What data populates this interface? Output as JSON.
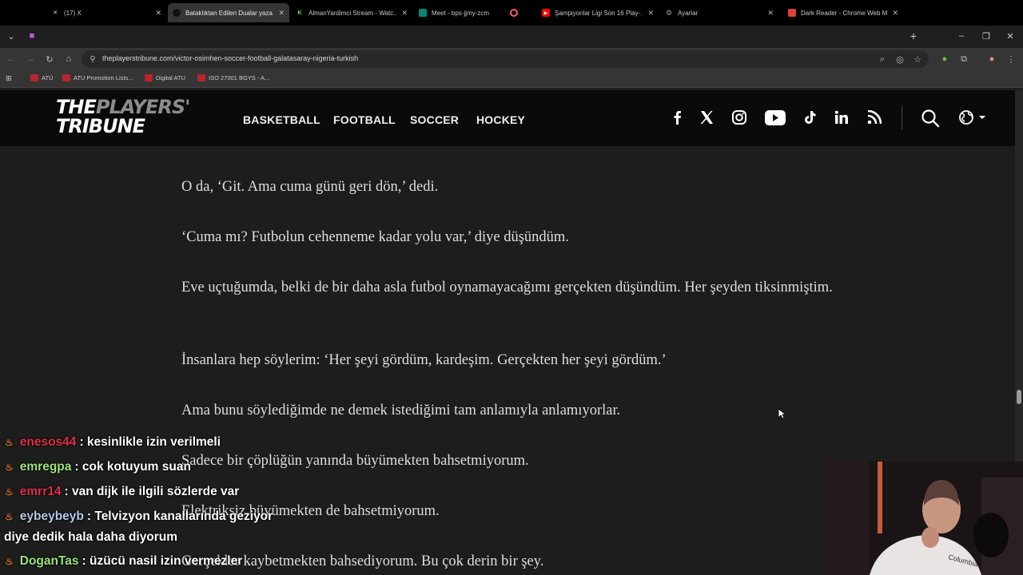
{
  "browser": {
    "tabs": [
      {
        "title": "(17) X",
        "icon": "x-logo-icon",
        "color": "#000000",
        "active": false
      },
      {
        "title": "Bataklıktan Edilen Dualar yaza...",
        "icon": "site-icon",
        "color": "#111111",
        "active": true
      },
      {
        "title": "AlmanYardimci Stream - Watc...",
        "icon": "kick-icon",
        "color": "#53fc18",
        "active": false
      },
      {
        "title": "Meet - bps-jjmy-zcm",
        "icon": "meet-icon",
        "color": "#00897b",
        "active": false
      },
      {
        "title": "",
        "icon": "recording-icon",
        "color": "#ff5a5a",
        "active": false
      },
      {
        "title": "Şampiyonlar Ligi Son 16 Play-...",
        "icon": "youtube-icon",
        "color": "#ff0000",
        "active": false
      },
      {
        "title": "Ayarlar",
        "icon": "gear-icon",
        "color": "#9aa0a6",
        "active": false
      },
      {
        "title": "Dark Reader - Chrome Web M...",
        "icon": "webstore-icon",
        "color": "#db4437",
        "active": false
      }
    ],
    "new_tab": "+",
    "url": "theplayerstribune.com/victor-osimhen-soccer-football-galatasaray-nigeria-turkish",
    "bookmarks": [
      "ATÜ",
      "ATU Promotion Lists...",
      "Digital ATU",
      "ISO 27001 BGYS - A..."
    ]
  },
  "site": {
    "logo_line1_a": "THE",
    "logo_line1_b": "PLAYERS'",
    "logo_line2": "TRIBUNE",
    "nav": [
      "BASKETBALL",
      "FOOTBALL",
      "SOCCER",
      "HOCKEY"
    ],
    "social_icons": [
      "facebook-icon",
      "x-icon",
      "instagram-icon",
      "youtube-icon",
      "tiktok-icon",
      "linkedin-icon",
      "rss-icon"
    ]
  },
  "article": {
    "paragraphs": [
      "O da, ‘Git. Ama cuma günü geri dön,’ dedi.",
      "‘Cuma mı? Futbolun cehenneme kadar yolu var,’ diye düşündüm.",
      "Eve uçtuğumda, belki de bir daha asla futbol oynamayacağımı gerçekten düşündüm. Her şeyden tiksinmiştim.",
      "İnsanlara hep söylerim: ‘Her şeyi gördüm, kardeşim. Gerçekten her şeyi gördüm.’",
      "Ama bunu söylediğimde ne demek istediğimi tam anlamıyla anlamıyorlar.",
      "Sadece bir çöplüğün yanında büyümekten bahsetmiyorum.",
      "Elektriksiz büyümekten de bahsetmiyorum.",
      "Gerçekler kaybetmekten bahsediyorum. Bu çok derin bir şey."
    ]
  },
  "chat": [
    {
      "user": "enesos44",
      "color": "#e0304a",
      "message": ": kesinlikle izin verilmeli"
    },
    {
      "user": "emregpa",
      "color": "#9be37a",
      "message": ": cok kotuyum suan"
    },
    {
      "user": "emrr14",
      "color": "#e0304a",
      "message": ": van dijk ile ilgili sözlerde var"
    },
    {
      "user": "eybeybeyb",
      "color": "#b6c6e8",
      "message": ": Telvizyon kanallarında geziyor"
    },
    {
      "user": "",
      "color": "#ffffff",
      "message": "diye dedik hala daha diyorum"
    },
    {
      "user": "DoganTas",
      "color": "#9be37a",
      "message": ": üzücü nasil izin vermezler"
    }
  ]
}
